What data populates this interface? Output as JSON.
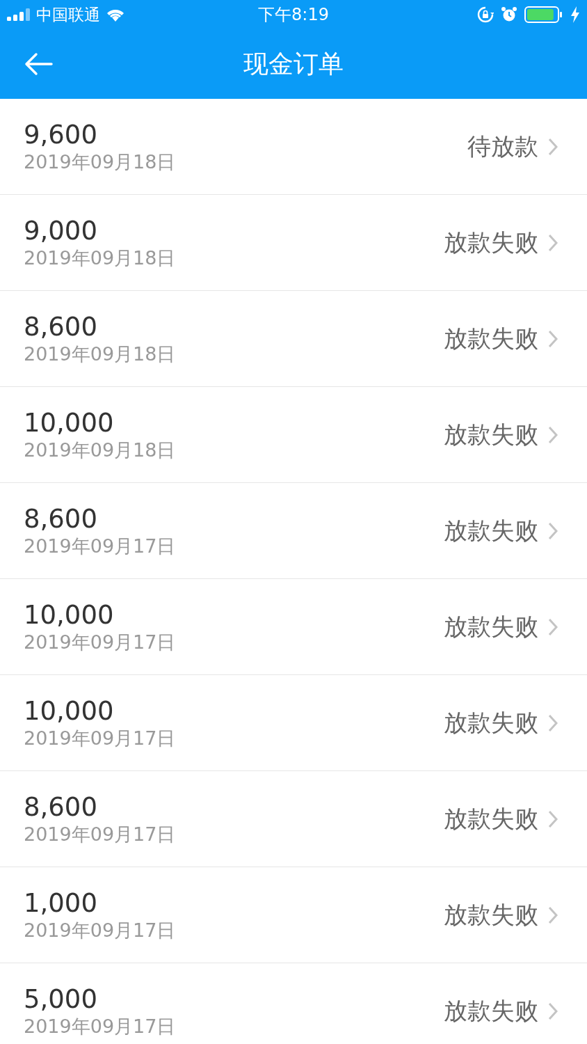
{
  "status_bar": {
    "carrier": "中国联通",
    "time": "下午8:19"
  },
  "nav": {
    "title": "现金订单"
  },
  "orders": [
    {
      "amount": "9,600",
      "date": "2019年09月18日",
      "status": "待放款"
    },
    {
      "amount": "9,000",
      "date": "2019年09月18日",
      "status": "放款失败"
    },
    {
      "amount": "8,600",
      "date": "2019年09月18日",
      "status": "放款失败"
    },
    {
      "amount": "10,000",
      "date": "2019年09月18日",
      "status": "放款失败"
    },
    {
      "amount": "8,600",
      "date": "2019年09月17日",
      "status": "放款失败"
    },
    {
      "amount": "10,000",
      "date": "2019年09月17日",
      "status": "放款失败"
    },
    {
      "amount": "10,000",
      "date": "2019年09月17日",
      "status": "放款失败"
    },
    {
      "amount": "8,600",
      "date": "2019年09月17日",
      "status": "放款失败"
    },
    {
      "amount": "1,000",
      "date": "2019年09月17日",
      "status": "放款失败"
    },
    {
      "amount": "5,000",
      "date": "2019年09月17日",
      "status": "放款失败"
    }
  ]
}
